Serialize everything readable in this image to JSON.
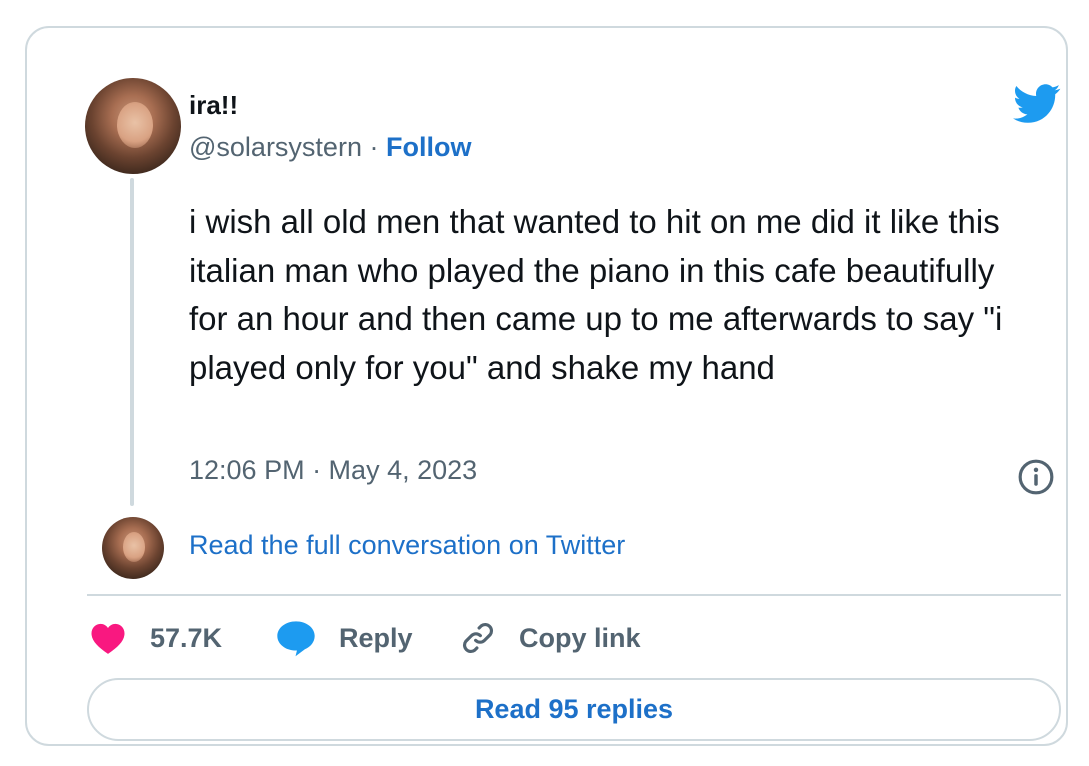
{
  "author": {
    "display_name": "ira!!",
    "handle": "@solarsystern",
    "separator": " · ",
    "follow_label": "Follow"
  },
  "tweet": {
    "text": "i wish all old men that wanted to hit on me did it like this italian man who played the piano in this cafe beautifully for an hour and then came up to me afterwards to say \"i played only for you\" and shake my hand",
    "timestamp": "12:06 PM · May 4, 2023"
  },
  "thread": {
    "full_conversation_label": "Read the full conversation on Twitter"
  },
  "actions": {
    "like_count": "57.7K",
    "reply_label": "Reply",
    "copy_link_label": "Copy link"
  },
  "footer": {
    "read_replies_label": "Read 95 replies"
  },
  "icons": {
    "brand": "twitter-bird-icon",
    "info": "info-icon",
    "like": "heart-icon",
    "reply": "speech-bubble-icon",
    "copy": "link-icon"
  },
  "colors": {
    "brand_blue": "#1d9bf0",
    "link_blue": "#1d70c8",
    "like_pink": "#f91880",
    "muted": "#536471",
    "border": "#cfd9de"
  }
}
